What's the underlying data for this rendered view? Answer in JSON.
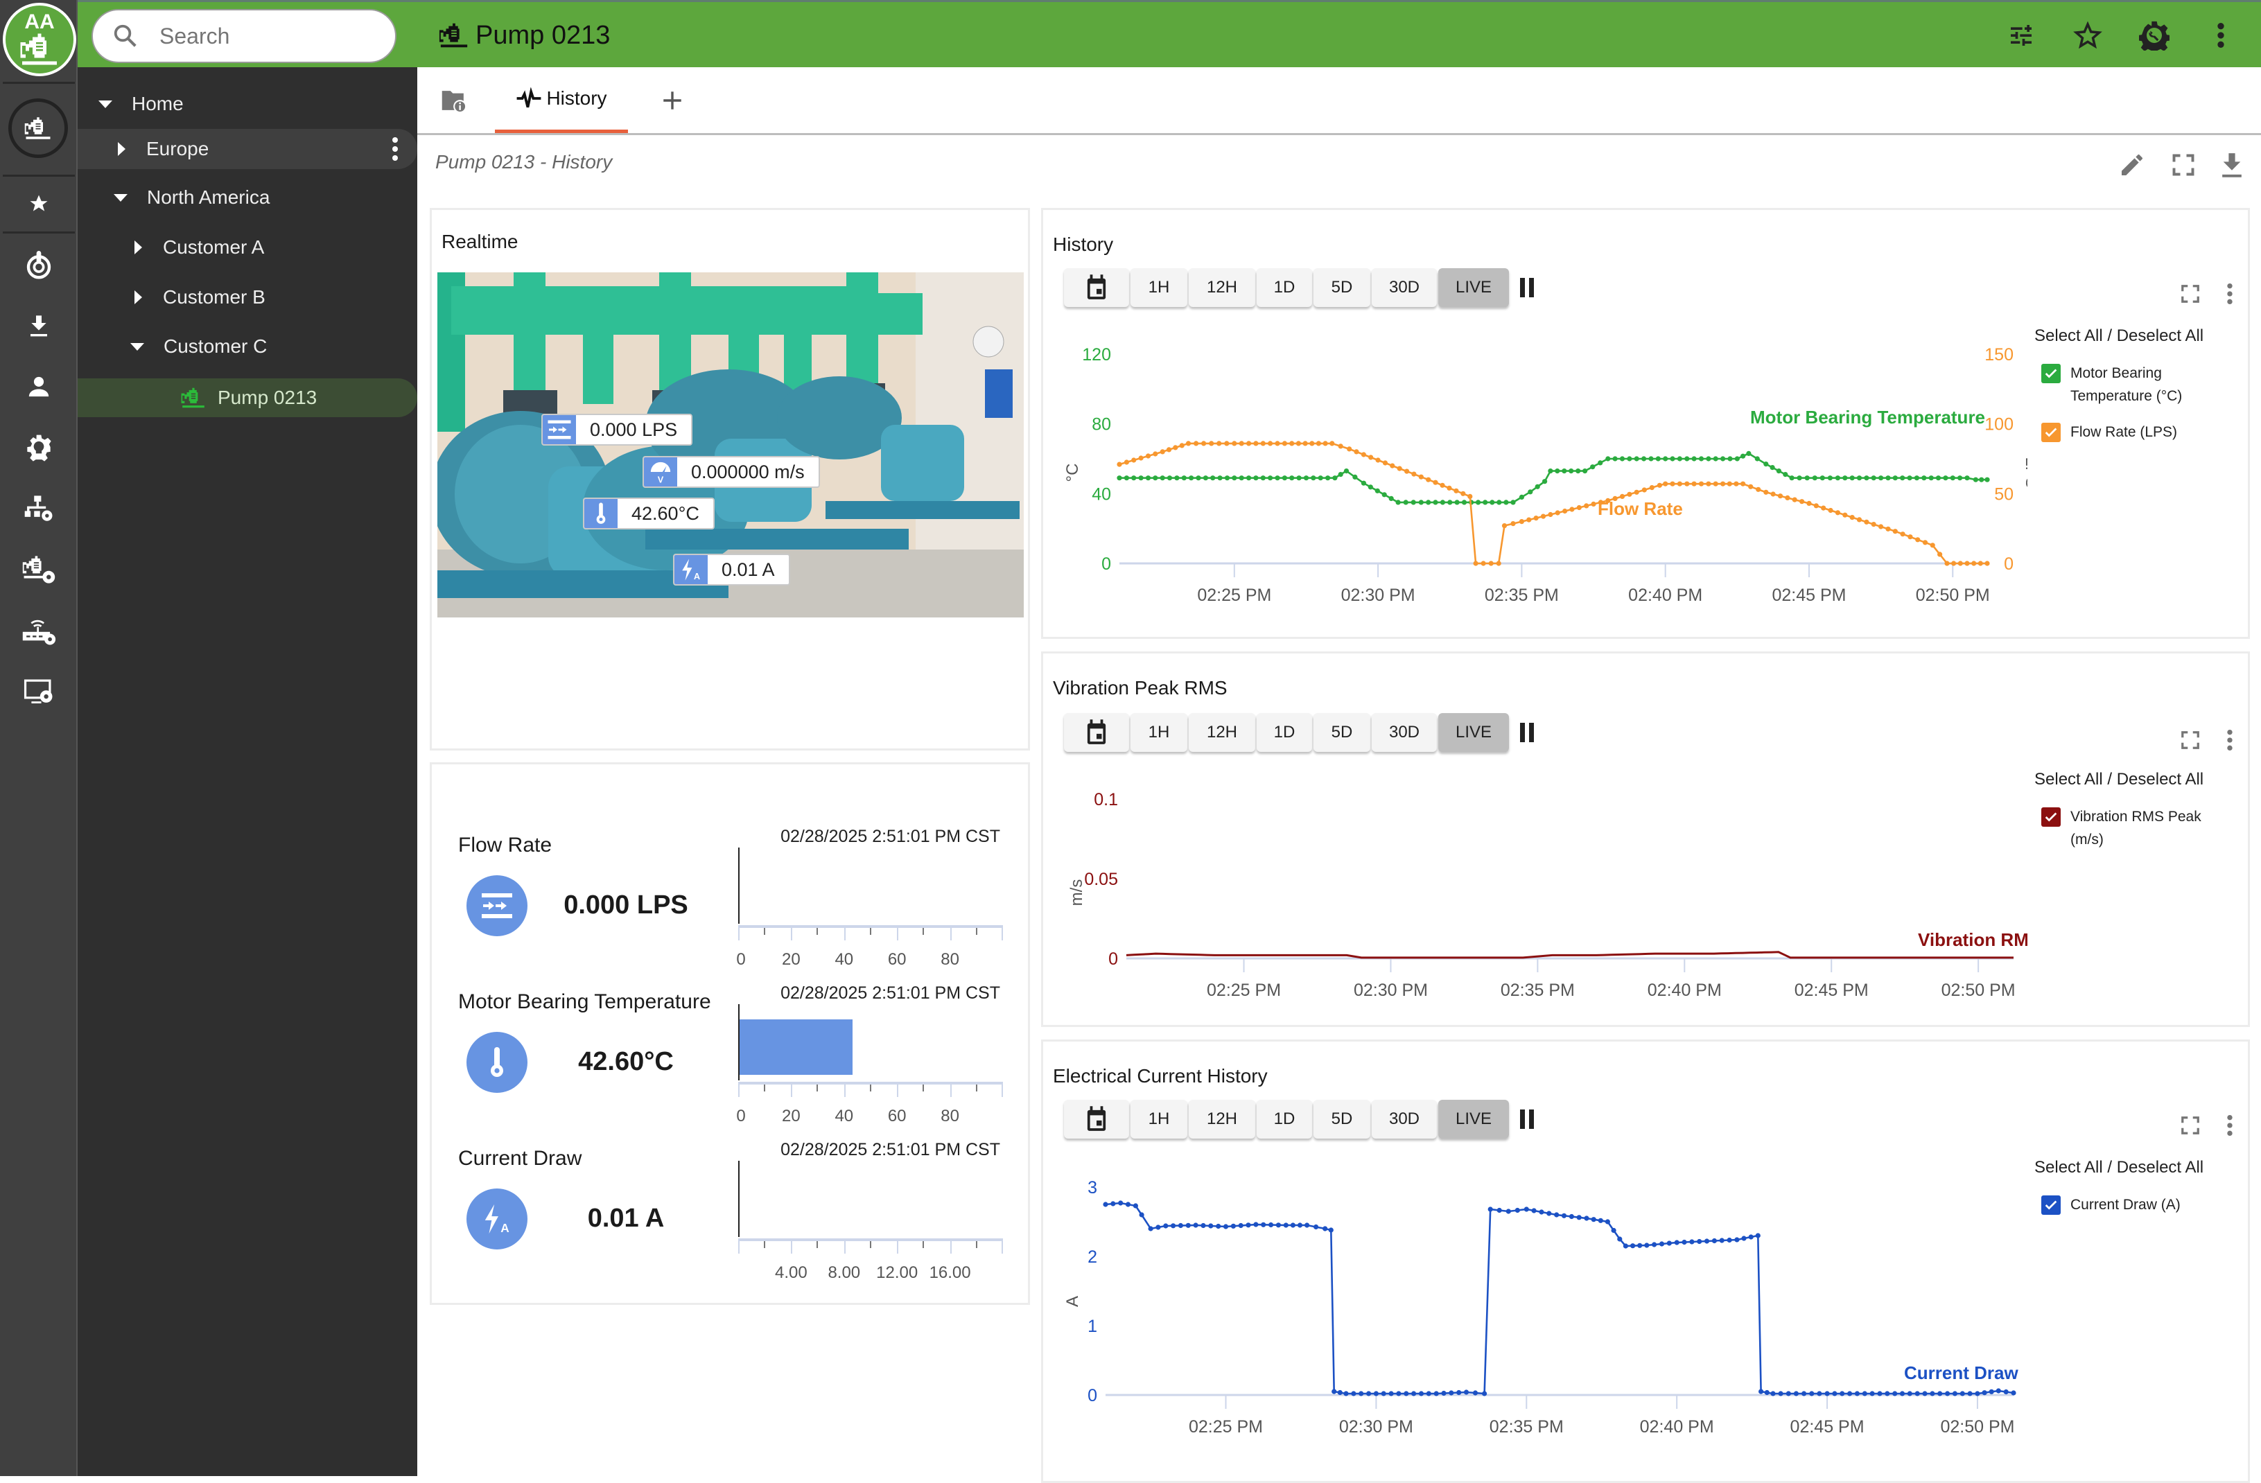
{
  "app": {
    "logo_text": "AA",
    "search": {
      "placeholder": "Search",
      "value": ""
    },
    "header_title": "Pump 0213",
    "header_icons": [
      "sliders-icon",
      "star-outline-icon",
      "gear-wrench-icon",
      "more-vert-icon"
    ]
  },
  "rail": {
    "items": [
      "pump-icon",
      "star-icon",
      "power-icon",
      "download-icon",
      "person-icon",
      "gear-bulb-icon",
      "hierarchy-gear-icon",
      "pump-gear-icon",
      "router-gear-icon",
      "monitor-gear-icon"
    ]
  },
  "tree": {
    "items": [
      {
        "label": "Home",
        "level": 0,
        "expanded": true
      },
      {
        "label": "Europe",
        "level": 1,
        "expanded": false
      },
      {
        "label": "North America",
        "level": 1,
        "expanded": true
      },
      {
        "label": "Customer A",
        "level": 2,
        "expanded": false
      },
      {
        "label": "Customer B",
        "level": 2,
        "expanded": false
      },
      {
        "label": "Customer C",
        "level": 2,
        "expanded": true
      },
      {
        "label": "Pump 0213",
        "level": 3,
        "selected": true
      }
    ]
  },
  "tabs": {
    "info_tab_icon": "folder-info-icon",
    "active_label": "History",
    "add_icon": "plus-icon"
  },
  "page": {
    "subtitle": "Pump 0213 - History",
    "tools": [
      "edit-icon",
      "fullscreen-icon",
      "download-icon"
    ]
  },
  "realtime": {
    "title": "Realtime",
    "overlays": [
      {
        "icon": "flow-icon",
        "value": "0.000 LPS"
      },
      {
        "icon": "vibration-gauge-icon",
        "value": "0.000000 m/s"
      },
      {
        "icon": "thermometer-icon",
        "value": "42.60°C"
      },
      {
        "icon": "current-icon",
        "value": "0.01 A"
      }
    ]
  },
  "gauges": [
    {
      "title": "Flow Rate",
      "timestamp": "02/28/2025 2:51:01 PM CST",
      "value": "0.000 LPS",
      "fill_value": 0,
      "scale_max": 100,
      "ticks": [
        "0",
        "20",
        "40",
        "60",
        "80"
      ],
      "icon": "flow-icon"
    },
    {
      "title": "Motor Bearing Temperature",
      "timestamp": "02/28/2025 2:51:01 PM CST",
      "value": "42.60°C",
      "fill_value": 42.6,
      "scale_max": 100,
      "ticks": [
        "0",
        "20",
        "40",
        "60",
        "80"
      ],
      "icon": "thermometer-icon"
    },
    {
      "title": "Current Draw",
      "timestamp": "02/28/2025 2:51:01 PM CST",
      "value": "0.01 A",
      "fill_value": 0.01,
      "scale_max": 20,
      "ticks": [
        "",
        "4.00",
        "8.00",
        "12.00",
        "16.00"
      ],
      "icon": "current-icon"
    }
  ],
  "range_buttons": [
    "1H",
    "12H",
    "1D",
    "5D",
    "30D",
    "LIVE"
  ],
  "active_range": "LIVE",
  "legend_select_all": "Select All / Deselect All",
  "colors": {
    "brand_green": "#5da73d",
    "temp": "#2bab3f",
    "flow": "#f7972f",
    "vibration": "#8b1010",
    "current": "#1c51c4",
    "gauge_blue": "#6794e2",
    "tab_accent": "#e8603c"
  },
  "chart_data": [
    {
      "id": "history",
      "type": "line",
      "title": "History",
      "x": [
        "02:21",
        "02:22",
        "02:23",
        "02:24",
        "02:25",
        "02:26",
        "02:27",
        "02:28",
        "02:29",
        "02:30",
        "02:31",
        "02:32",
        "02:33",
        "02:33.5",
        "02:34",
        "02:34.5",
        "02:35",
        "02:36",
        "02:37",
        "02:38",
        "02:39",
        "02:40",
        "02:41",
        "02:42",
        "02:43",
        "02:44",
        "02:45",
        "02:46",
        "02:47",
        "02:48",
        "02:49",
        "02:50",
        "02:51"
      ],
      "xticks": [
        "02:25 PM",
        "02:30 PM",
        "02:35 PM",
        "02:40 PM",
        "02:45 PM",
        "02:50 PM"
      ],
      "x_range_minutes": [
        21,
        51.2
      ],
      "series": [
        {
          "name": "Motor Bearing Temperature",
          "legend": "Motor Bearing Temperature (°C)",
          "axis": "left",
          "color": "#2bab3f",
          "points": [
            [
              21,
              49
            ],
            [
              22,
              49
            ],
            [
              23,
              49
            ],
            [
              24,
              49
            ],
            [
              25,
              49
            ],
            [
              26,
              49
            ],
            [
              27,
              49
            ],
            [
              28.5,
              49
            ],
            [
              28.9,
              53
            ],
            [
              29.5,
              46
            ],
            [
              30.7,
              35
            ],
            [
              31.5,
              35
            ],
            [
              33,
              35
            ],
            [
              34.7,
              35
            ],
            [
              35.3,
              41
            ],
            [
              35.8,
              47
            ],
            [
              36,
              53
            ],
            [
              37.2,
              53
            ],
            [
              38,
              60
            ],
            [
              40,
              60
            ],
            [
              41,
              60
            ],
            [
              42.5,
              60
            ],
            [
              42.9,
              63
            ],
            [
              43.5,
              57
            ],
            [
              44.4,
              49
            ],
            [
              46,
              49
            ],
            [
              48,
              49
            ],
            [
              49,
              49
            ],
            [
              50.5,
              49
            ],
            [
              50.8,
              48
            ],
            [
              51.2,
              48
            ]
          ]
        },
        {
          "name": "Flow Rate",
          "legend": "Flow Rate (LPS)",
          "axis": "right",
          "color": "#f7972f",
          "points": [
            [
              21,
              71
            ],
            [
              22.5,
              80
            ],
            [
              23.4,
              86
            ],
            [
              25,
              86
            ],
            [
              27,
              86
            ],
            [
              28.4,
              86
            ],
            [
              29,
              82
            ],
            [
              30,
              74
            ],
            [
              31,
              66
            ],
            [
              32,
              58
            ],
            [
              33.2,
              48
            ],
            [
              33.4,
              0
            ],
            [
              34.2,
              0
            ],
            [
              34.4,
              27
            ],
            [
              35,
              30
            ],
            [
              36,
              35
            ],
            [
              37,
              40
            ],
            [
              38,
              45
            ],
            [
              39,
              51
            ],
            [
              39.8,
              56
            ],
            [
              40,
              57
            ],
            [
              41,
              57
            ],
            [
              42,
              57
            ],
            [
              42.7,
              57
            ],
            [
              43.5,
              51
            ],
            [
              45,
              43
            ],
            [
              46.5,
              33
            ],
            [
              48,
              23
            ],
            [
              49.3,
              13
            ],
            [
              49.8,
              0
            ],
            [
              51.2,
              0
            ]
          ]
        }
      ],
      "y_left": {
        "label": "°C",
        "ticks": [
          0,
          40,
          80,
          120
        ],
        "range": [
          0,
          120
        ]
      },
      "y_right": {
        "label": "LPS",
        "ticks": [
          0,
          50,
          100,
          150
        ],
        "range": [
          0,
          150
        ]
      },
      "annotations": [
        "Motor Bearing Temperature",
        "Flow Rate"
      ],
      "legend_position": "right"
    },
    {
      "id": "vibration",
      "type": "line",
      "title": "Vibration Peak RMS",
      "xticks": [
        "02:25 PM",
        "02:30 PM",
        "02:35 PM",
        "02:40 PM",
        "02:45 PM",
        "02:50 PM"
      ],
      "x_range_minutes": [
        21,
        51.2
      ],
      "series": [
        {
          "name": "Vibration RMS Peak",
          "legend": "Vibration RMS Peak (m/s)",
          "color": "#8b1010",
          "points": [
            [
              21,
              0.002
            ],
            [
              22,
              0.003
            ],
            [
              24,
              0.002
            ],
            [
              26,
              0.002
            ],
            [
              28.5,
              0.002
            ],
            [
              29,
              0.0005
            ],
            [
              33,
              0.0005
            ],
            [
              34.5,
              0.0005
            ],
            [
              35.5,
              0.002
            ],
            [
              37,
              0.002
            ],
            [
              39,
              0.003
            ],
            [
              41,
              0.003
            ],
            [
              43.2,
              0.004
            ],
            [
              43.6,
              0.0005
            ],
            [
              47,
              0.0005
            ],
            [
              51.2,
              0.0005
            ]
          ]
        }
      ],
      "y_left": {
        "label": "m/s",
        "ticks": [
          0,
          0.05,
          0.1
        ],
        "range": [
          0,
          0.1
        ]
      },
      "annotations": [
        "Vibration RMS Peak"
      ],
      "legend_position": "right"
    },
    {
      "id": "current",
      "type": "line",
      "title": "Electrical Current History",
      "xticks": [
        "02:25 PM",
        "02:30 PM",
        "02:35 PM",
        "02:40 PM",
        "02:45 PM",
        "02:50 PM"
      ],
      "x_range_minutes": [
        21,
        51.2
      ],
      "series": [
        {
          "name": "Current Draw",
          "legend": "Current Draw (A)",
          "color": "#1c51c4",
          "points": [
            [
              21,
              2.75
            ],
            [
              21.5,
              2.77
            ],
            [
              22,
              2.73
            ],
            [
              22.2,
              2.6
            ],
            [
              22.5,
              2.4
            ],
            [
              23,
              2.44
            ],
            [
              24,
              2.45
            ],
            [
              25,
              2.43
            ],
            [
              26,
              2.46
            ],
            [
              27,
              2.45
            ],
            [
              27.7,
              2.45
            ],
            [
              28.3,
              2.4
            ],
            [
              28.5,
              2.38
            ],
            [
              28.6,
              0.05
            ],
            [
              29,
              0.02
            ],
            [
              30,
              0.02
            ],
            [
              31,
              0.02
            ],
            [
              32,
              0.02
            ],
            [
              33,
              0.04
            ],
            [
              33.6,
              0.02
            ],
            [
              33.8,
              2.68
            ],
            [
              34.4,
              2.65
            ],
            [
              35,
              2.68
            ],
            [
              36,
              2.6
            ],
            [
              37,
              2.55
            ],
            [
              37.7,
              2.5
            ],
            [
              38.1,
              2.25
            ],
            [
              38.3,
              2.15
            ],
            [
              39,
              2.16
            ],
            [
              40,
              2.2
            ],
            [
              41,
              2.22
            ],
            [
              42,
              2.24
            ],
            [
              42.7,
              2.3
            ],
            [
              42.8,
              0.05
            ],
            [
              43.2,
              0.02
            ],
            [
              45,
              0.02
            ],
            [
              47,
              0.02
            ],
            [
              50,
              0.02
            ],
            [
              50.7,
              0.06
            ],
            [
              51.2,
              0.03
            ]
          ]
        }
      ],
      "y_left": {
        "label": "A",
        "ticks": [
          0,
          1,
          2,
          3
        ],
        "range": [
          0,
          3.1
        ]
      },
      "annotations": [
        "Current Draw"
      ],
      "legend_position": "right"
    }
  ]
}
